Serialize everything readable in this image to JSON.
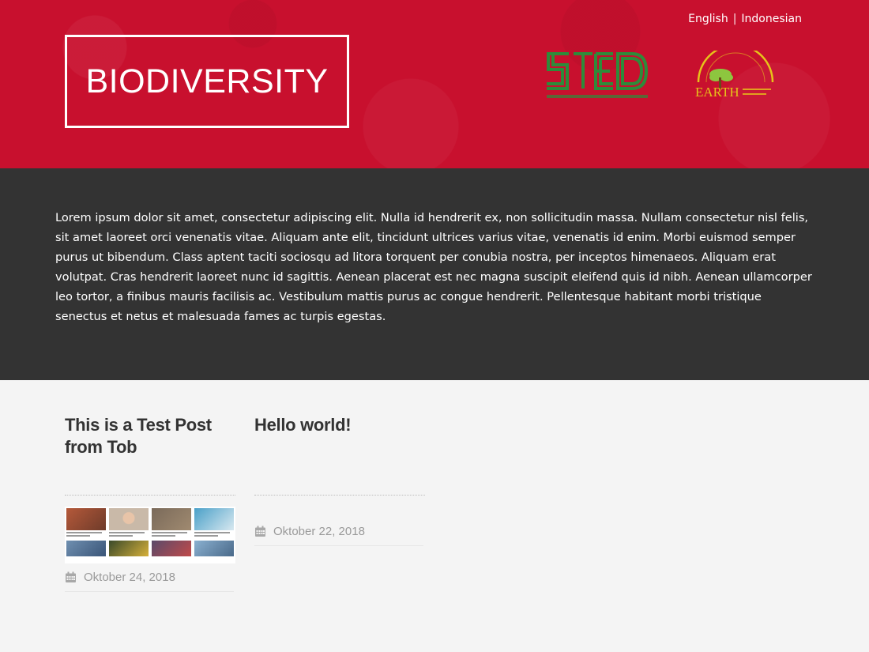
{
  "header": {
    "languages": [
      "English",
      "Indonesian"
    ],
    "separator": "|",
    "site_title": "BIODIVERSITY",
    "brand_color": "#c8102e"
  },
  "intro": {
    "text": "Lorem ipsum dolor sit amet, consectetur adipiscing elit. Nulla id hendrerit ex, non sollicitudin massa. Nullam consectetur nisl felis, sit amet laoreet orci venenatis vitae. Aliquam ante elit, tincidunt ultrices varius vitae, venenatis id enim. Morbi euismod semper purus ut bibendum. Class aptent taciti sociosqu ad litora torquent per conubia nostra, per inceptos himenaeos. Aliquam erat volutpat. Cras hendrerit laoreet nunc id sagittis. Aenean placerat est nec magna suscipit eleifend quis id nibh. Aenean ullamcorper leo tortor, a finibus mauris facilisis ac. Vestibulum mattis purus ac congue hendrerit. Pellentesque habitant morbi tristique senectus et netus et malesuada fames ac turpis egestas.",
    "background": "#333333"
  },
  "posts": [
    {
      "title": "This is a Test Post from Tob",
      "date": "Oktober 24, 2018",
      "has_thumbnail": true,
      "date_icon": "calendar-icon"
    },
    {
      "title": "Hello world!",
      "date": "Oktober 22, 2018",
      "has_thumbnail": false,
      "date_icon": "calendar-icon"
    }
  ]
}
